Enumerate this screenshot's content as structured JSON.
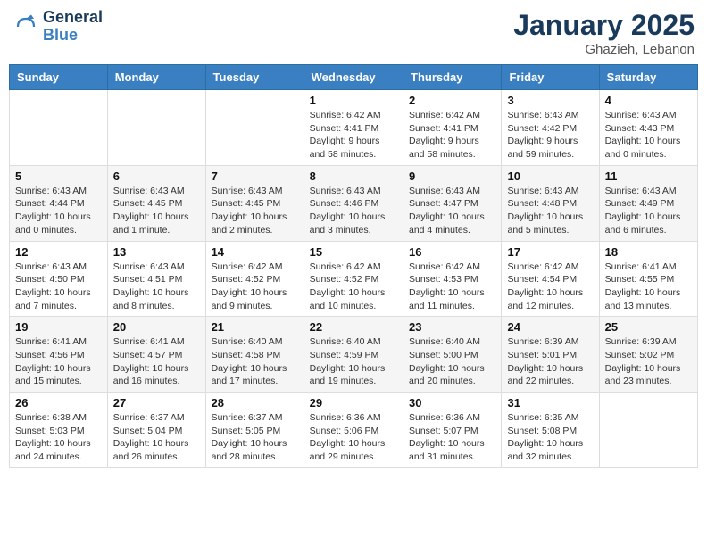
{
  "header": {
    "logo_line1": "General",
    "logo_line2": "Blue",
    "month": "January 2025",
    "location": "Ghazieh, Lebanon"
  },
  "days_of_week": [
    "Sunday",
    "Monday",
    "Tuesday",
    "Wednesday",
    "Thursday",
    "Friday",
    "Saturday"
  ],
  "weeks": [
    {
      "cells": [
        {
          "day": "",
          "info": ""
        },
        {
          "day": "",
          "info": ""
        },
        {
          "day": "",
          "info": ""
        },
        {
          "day": "1",
          "info": "Sunrise: 6:42 AM\nSunset: 4:41 PM\nDaylight: 9 hours\nand 58 minutes."
        },
        {
          "day": "2",
          "info": "Sunrise: 6:42 AM\nSunset: 4:41 PM\nDaylight: 9 hours\nand 58 minutes."
        },
        {
          "day": "3",
          "info": "Sunrise: 6:43 AM\nSunset: 4:42 PM\nDaylight: 9 hours\nand 59 minutes."
        },
        {
          "day": "4",
          "info": "Sunrise: 6:43 AM\nSunset: 4:43 PM\nDaylight: 10 hours\nand 0 minutes."
        }
      ]
    },
    {
      "cells": [
        {
          "day": "5",
          "info": "Sunrise: 6:43 AM\nSunset: 4:44 PM\nDaylight: 10 hours\nand 0 minutes."
        },
        {
          "day": "6",
          "info": "Sunrise: 6:43 AM\nSunset: 4:45 PM\nDaylight: 10 hours\nand 1 minute."
        },
        {
          "day": "7",
          "info": "Sunrise: 6:43 AM\nSunset: 4:45 PM\nDaylight: 10 hours\nand 2 minutes."
        },
        {
          "day": "8",
          "info": "Sunrise: 6:43 AM\nSunset: 4:46 PM\nDaylight: 10 hours\nand 3 minutes."
        },
        {
          "day": "9",
          "info": "Sunrise: 6:43 AM\nSunset: 4:47 PM\nDaylight: 10 hours\nand 4 minutes."
        },
        {
          "day": "10",
          "info": "Sunrise: 6:43 AM\nSunset: 4:48 PM\nDaylight: 10 hours\nand 5 minutes."
        },
        {
          "day": "11",
          "info": "Sunrise: 6:43 AM\nSunset: 4:49 PM\nDaylight: 10 hours\nand 6 minutes."
        }
      ]
    },
    {
      "cells": [
        {
          "day": "12",
          "info": "Sunrise: 6:43 AM\nSunset: 4:50 PM\nDaylight: 10 hours\nand 7 minutes."
        },
        {
          "day": "13",
          "info": "Sunrise: 6:43 AM\nSunset: 4:51 PM\nDaylight: 10 hours\nand 8 minutes."
        },
        {
          "day": "14",
          "info": "Sunrise: 6:42 AM\nSunset: 4:52 PM\nDaylight: 10 hours\nand 9 minutes."
        },
        {
          "day": "15",
          "info": "Sunrise: 6:42 AM\nSunset: 4:52 PM\nDaylight: 10 hours\nand 10 minutes."
        },
        {
          "day": "16",
          "info": "Sunrise: 6:42 AM\nSunset: 4:53 PM\nDaylight: 10 hours\nand 11 minutes."
        },
        {
          "day": "17",
          "info": "Sunrise: 6:42 AM\nSunset: 4:54 PM\nDaylight: 10 hours\nand 12 minutes."
        },
        {
          "day": "18",
          "info": "Sunrise: 6:41 AM\nSunset: 4:55 PM\nDaylight: 10 hours\nand 13 minutes."
        }
      ]
    },
    {
      "cells": [
        {
          "day": "19",
          "info": "Sunrise: 6:41 AM\nSunset: 4:56 PM\nDaylight: 10 hours\nand 15 minutes."
        },
        {
          "day": "20",
          "info": "Sunrise: 6:41 AM\nSunset: 4:57 PM\nDaylight: 10 hours\nand 16 minutes."
        },
        {
          "day": "21",
          "info": "Sunrise: 6:40 AM\nSunset: 4:58 PM\nDaylight: 10 hours\nand 17 minutes."
        },
        {
          "day": "22",
          "info": "Sunrise: 6:40 AM\nSunset: 4:59 PM\nDaylight: 10 hours\nand 19 minutes."
        },
        {
          "day": "23",
          "info": "Sunrise: 6:40 AM\nSunset: 5:00 PM\nDaylight: 10 hours\nand 20 minutes."
        },
        {
          "day": "24",
          "info": "Sunrise: 6:39 AM\nSunset: 5:01 PM\nDaylight: 10 hours\nand 22 minutes."
        },
        {
          "day": "25",
          "info": "Sunrise: 6:39 AM\nSunset: 5:02 PM\nDaylight: 10 hours\nand 23 minutes."
        }
      ]
    },
    {
      "cells": [
        {
          "day": "26",
          "info": "Sunrise: 6:38 AM\nSunset: 5:03 PM\nDaylight: 10 hours\nand 24 minutes."
        },
        {
          "day": "27",
          "info": "Sunrise: 6:37 AM\nSunset: 5:04 PM\nDaylight: 10 hours\nand 26 minutes."
        },
        {
          "day": "28",
          "info": "Sunrise: 6:37 AM\nSunset: 5:05 PM\nDaylight: 10 hours\nand 28 minutes."
        },
        {
          "day": "29",
          "info": "Sunrise: 6:36 AM\nSunset: 5:06 PM\nDaylight: 10 hours\nand 29 minutes."
        },
        {
          "day": "30",
          "info": "Sunrise: 6:36 AM\nSunset: 5:07 PM\nDaylight: 10 hours\nand 31 minutes."
        },
        {
          "day": "31",
          "info": "Sunrise: 6:35 AM\nSunset: 5:08 PM\nDaylight: 10 hours\nand 32 minutes."
        },
        {
          "day": "",
          "info": ""
        }
      ]
    }
  ]
}
